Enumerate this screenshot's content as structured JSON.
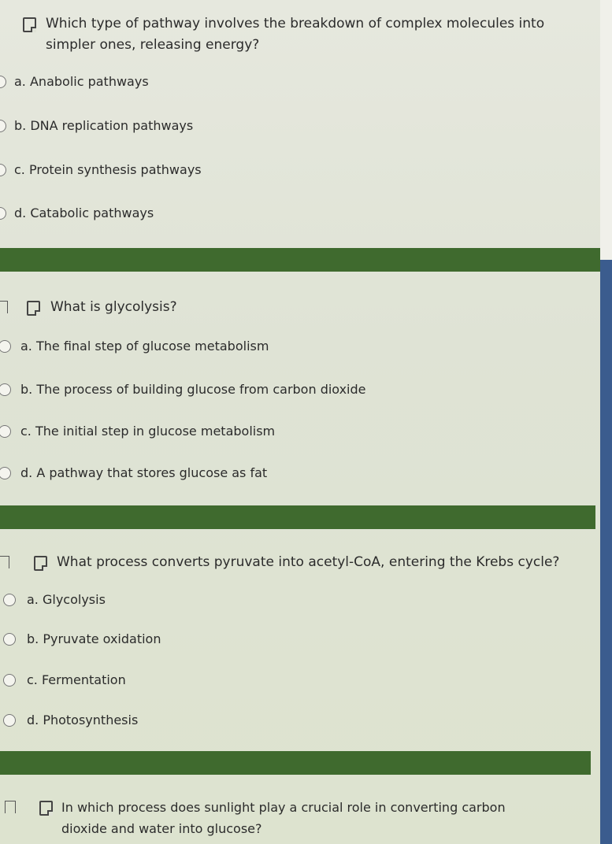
{
  "questions": [
    {
      "text": "Which type of pathway involves the breakdown of complex molecules into simpler ones, releasing energy?",
      "line1": "Which type of pathway involves the breakdown of complex molecules into",
      "line2": "simpler ones, releasing energy?",
      "options": [
        "a. Anabolic pathways",
        "b. DNA replication pathways",
        "c. Protein synthesis pathways",
        "d. Catabolic pathways"
      ]
    },
    {
      "text": "What is glycolysis?",
      "line1": "What is glycolysis?",
      "options": [
        "a. The final step of glucose metabolism",
        "b. The process of building glucose from carbon dioxide",
        "c. The initial step in glucose metabolism",
        "d. A pathway that stores glucose as fat"
      ]
    },
    {
      "text": "What process converts pyruvate into acetyl-CoA, entering the Krebs cycle?",
      "line1": "What process converts pyruvate into acetyl-CoA, entering the Krebs cycle?",
      "options": [
        "a. Glycolysis",
        "b. Pyruvate oxidation",
        "c. Fermentation",
        "d. Photosynthesis"
      ]
    },
    {
      "text": "In which process does sunlight play a crucial role in converting carbon dioxide and water into glucose?",
      "line1": "In which process does sunlight play a crucial role in converting carbon",
      "line2": "dioxide and water into glucose?"
    }
  ],
  "colors": {
    "divider": "#3f6a2e",
    "scrollbar": "#3b5c8e"
  }
}
